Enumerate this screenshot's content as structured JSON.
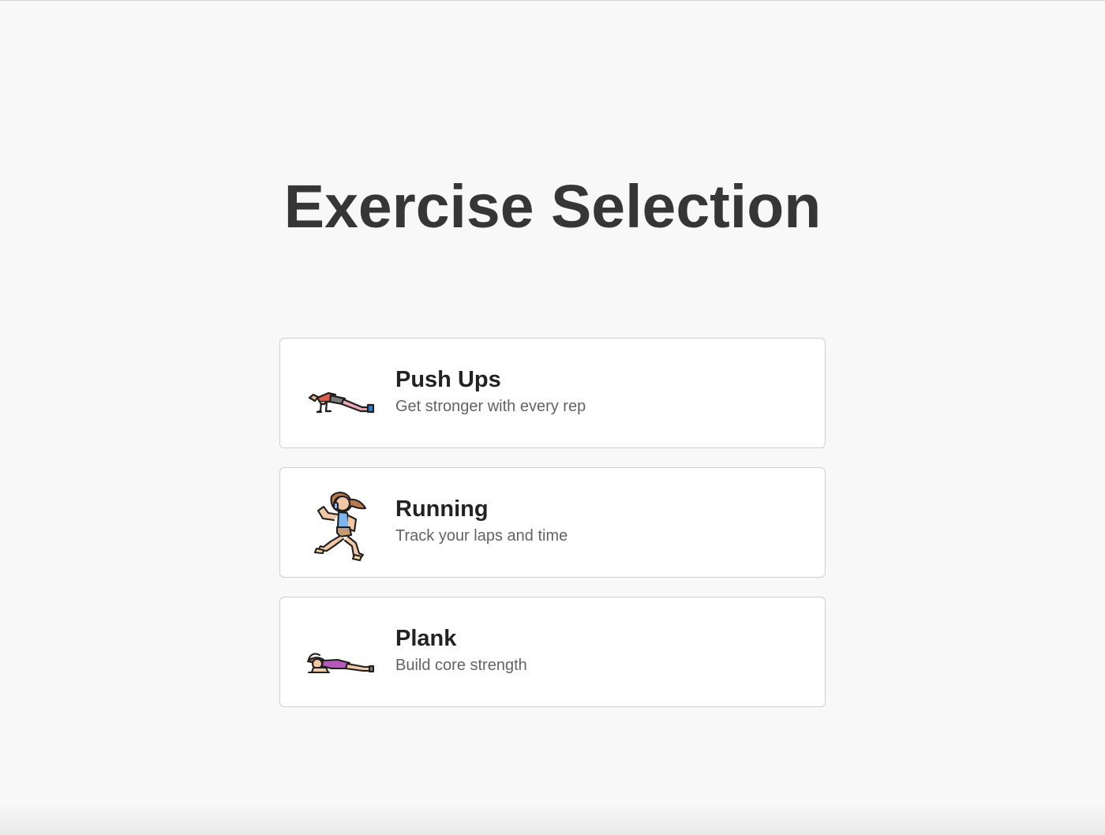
{
  "page": {
    "title": "Exercise Selection"
  },
  "exercises": [
    {
      "title": "Push Ups",
      "description": "Get stronger with every rep",
      "icon": "push-up-icon"
    },
    {
      "title": "Running",
      "description": "Track your laps and time",
      "icon": "running-icon"
    },
    {
      "title": "Plank",
      "description": "Build core strength",
      "icon": "plank-icon"
    }
  ],
  "colors": {
    "background": "#f8f8f8",
    "card_background": "#ffffff",
    "card_border": "#cfcfcf",
    "title_text": "#363636",
    "card_title_text": "#222222",
    "card_description_text": "#636363"
  }
}
